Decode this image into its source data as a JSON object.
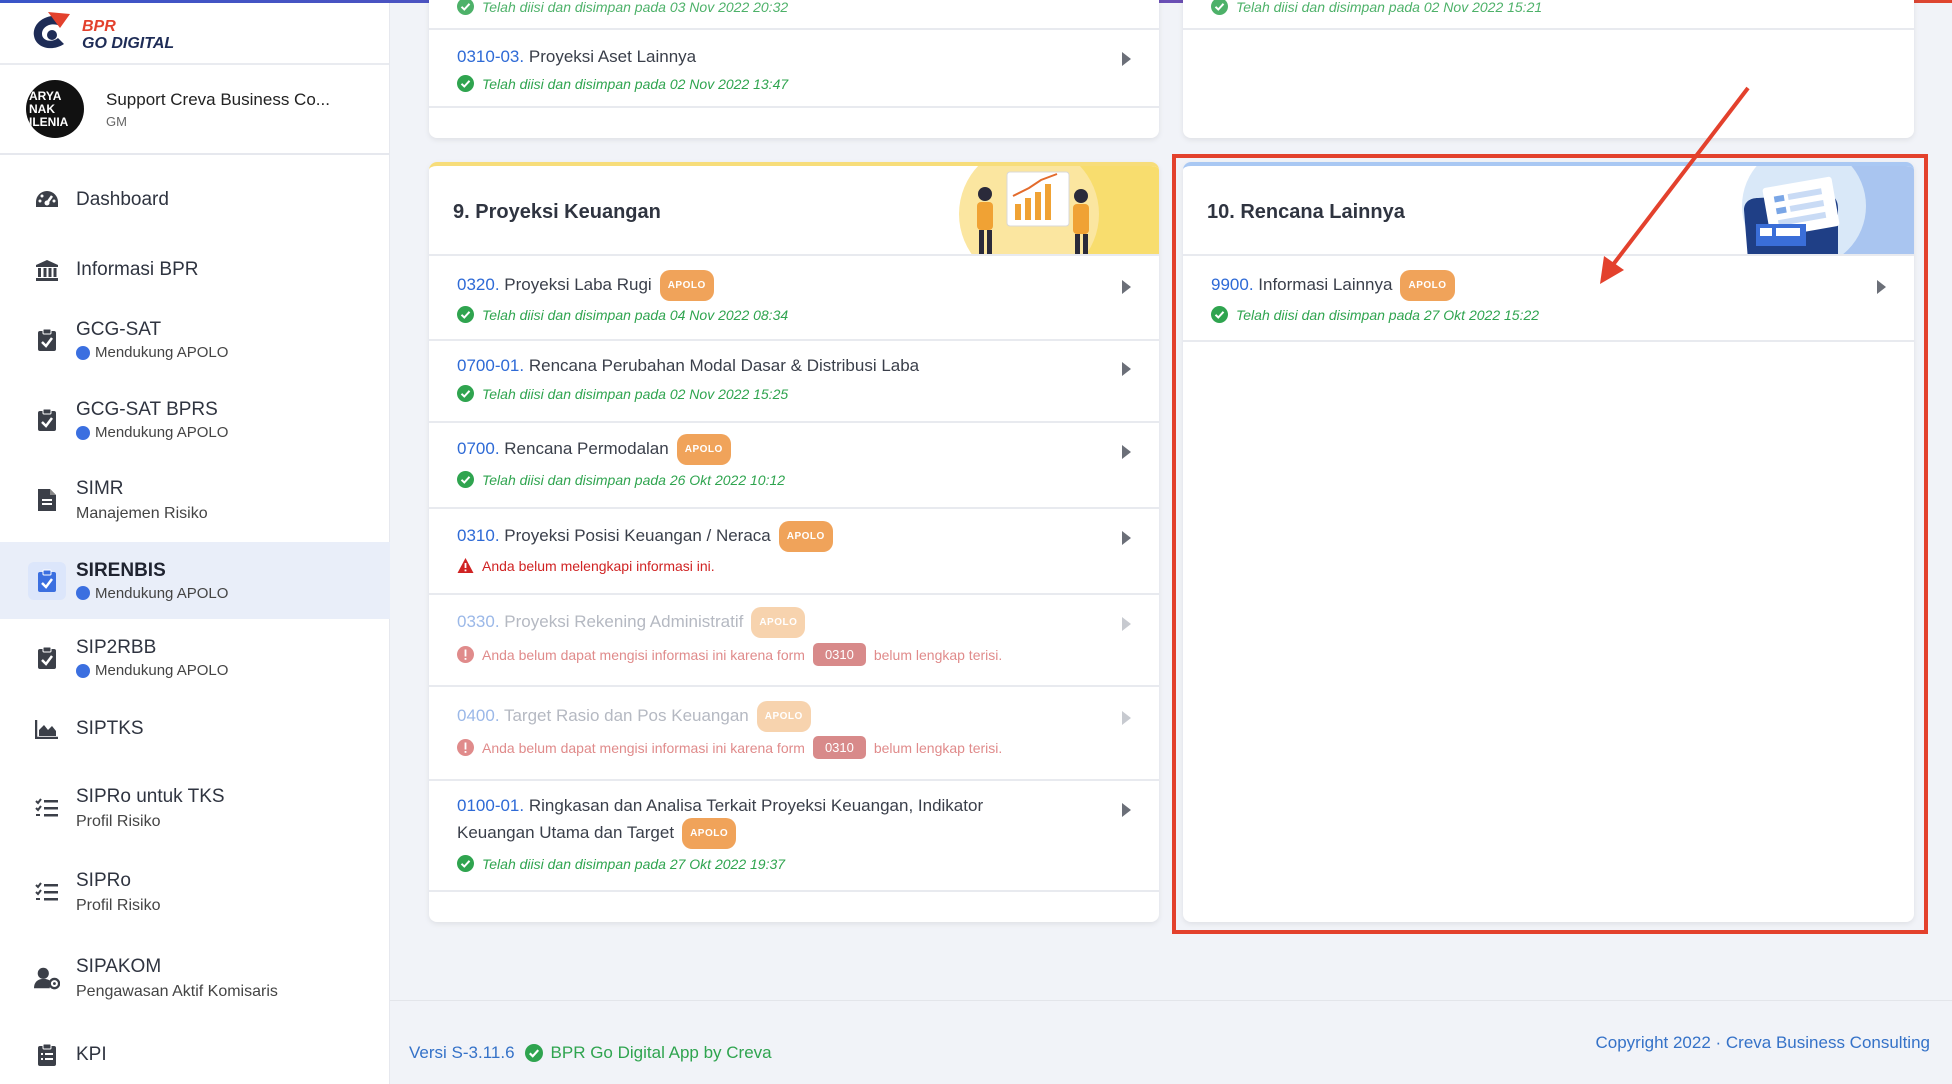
{
  "brand": {
    "line1": "BPR",
    "line2": "GO DIGITAL"
  },
  "user": {
    "name": "Support Creva Business Co...",
    "role": "GM",
    "avatar_text": [
      "ARYA",
      "NAK",
      "ILENIA"
    ]
  },
  "sidebar": {
    "items": [
      {
        "label": "Dashboard",
        "icon": "gauge-icon"
      },
      {
        "label": "Informasi BPR",
        "icon": "bank-icon"
      },
      {
        "label": "GCG-SAT",
        "sub": "Mendukung APOLO",
        "icon": "clipboard-check-icon"
      },
      {
        "label": "GCG-SAT BPRS",
        "sub": "Mendukung APOLO",
        "icon": "clipboard-check-icon"
      },
      {
        "label": "SIMR",
        "sub": "Manajemen Risiko",
        "icon": "document-icon"
      },
      {
        "label": "SIRENBIS",
        "sub": "Mendukung APOLO",
        "icon": "clipboard-check-icon",
        "active": true
      },
      {
        "label": "SIP2RBB",
        "sub": "Mendukung APOLO",
        "icon": "clipboard-check-icon"
      },
      {
        "label": "SIPTKS",
        "icon": "area-chart-icon"
      },
      {
        "label": "SIPRo untuk TKS",
        "sub": "Profil Risiko",
        "icon": "checklist-icon"
      },
      {
        "label": "SIPRo",
        "sub": "Profil Risiko",
        "icon": "checklist-icon"
      },
      {
        "label": "SIPAKOM",
        "sub": "Pengawasan Aktif Komisaris",
        "icon": "user-gear-icon"
      },
      {
        "label": "KPI",
        "icon": "clipboard-list-icon"
      }
    ]
  },
  "top_left_card": {
    "partial_status": "Telah diisi dan disimpan pada 03 Nov 2022 20:32",
    "row": {
      "code": "0310-03.",
      "title": "Proyeksi Aset Lainnya",
      "status": "Telah diisi dan disimpan pada 02 Nov 2022 13:47"
    }
  },
  "top_right_card": {
    "partial_status": "Telah diisi dan disimpan pada 02 Nov 2022 15:21"
  },
  "card9": {
    "title": "9. Proyeksi Keuangan",
    "rows": [
      {
        "code": "0320.",
        "title": "Proyeksi Laba Rugi",
        "badge": "APOLO",
        "status": "Telah diisi dan disimpan pada 04 Nov 2022 08:34"
      },
      {
        "code": "0700-01.",
        "title": "Rencana Perubahan Modal Dasar & Distribusi Laba",
        "status": "Telah diisi dan disimpan pada 02 Nov 2022 15:25"
      },
      {
        "code": "0700.",
        "title": "Rencana Permodalan",
        "badge": "APOLO",
        "status": "Telah diisi dan disimpan pada 26 Okt 2022 10:12"
      },
      {
        "code": "0310.",
        "title": "Proyeksi Posisi Keuangan / Neraca",
        "badge": "APOLO",
        "status": "Anda belum melengkapi informasi ini."
      },
      {
        "code": "0330.",
        "title": "Proyeksi Rekening Administratif",
        "badge": "APOLO",
        "status_a": "Anda belum dapat mengisi informasi ini karena form",
        "form": "0310",
        "status_b": "belum lengkap terisi."
      },
      {
        "code": "0400.",
        "title": "Target Rasio dan Pos Keuangan",
        "badge": "APOLO",
        "status_a": "Anda belum dapat mengisi informasi ini karena form",
        "form": "0310",
        "status_b": "belum lengkap terisi."
      },
      {
        "code": "0100-01.",
        "title_line1": "Ringkasan dan Analisa Terkait Proyeksi Keuangan, Indikator",
        "title_line2": "Keuangan Utama dan Target",
        "badge": "APOLO",
        "status": "Telah diisi dan disimpan pada 27 Okt 2022 19:37"
      }
    ]
  },
  "card10": {
    "title": "10. Rencana Lainnya",
    "rows": [
      {
        "code": "9900.",
        "title": "Informasi Lainnya",
        "badge": "APOLO",
        "status": "Telah diisi dan disimpan pada 27 Okt 2022 15:22"
      }
    ]
  },
  "footer": {
    "version": "Versi S-3.11.6",
    "app": "BPR Go Digital App by Creva",
    "copyright": "Copyright 2022 · Creva Business Consulting"
  },
  "colors": {
    "accent": "#2e6ad6",
    "success": "#2fa44f",
    "apolo_badge": "#f0a35a",
    "annotation": "#e3412d"
  }
}
